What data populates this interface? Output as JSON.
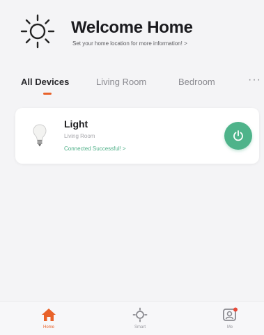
{
  "header": {
    "title": "Welcome Home",
    "subtitle": "Set your home location for more information! >",
    "icon": "sun-icon"
  },
  "tabs": [
    {
      "label": "All Devices",
      "active": true
    },
    {
      "label": "Living Room",
      "active": false
    },
    {
      "label": "Bedroom",
      "active": false
    }
  ],
  "tab_more_label": "···",
  "device": {
    "name": "Light",
    "room": "Living Room",
    "status": "Connected Successful! >",
    "icon": "light-bulb-icon",
    "power_icon": "power-icon"
  },
  "nav": [
    {
      "label": "Home",
      "icon": "home-icon",
      "active": true
    },
    {
      "label": "Smart",
      "icon": "smart-icon",
      "active": false
    },
    {
      "label": "Me",
      "icon": "me-icon",
      "active": false
    }
  ],
  "colors": {
    "accent": "#e8622a",
    "power_button": "#4eb38a",
    "status_text": "#4caf86",
    "background": "#f4f4f6"
  }
}
